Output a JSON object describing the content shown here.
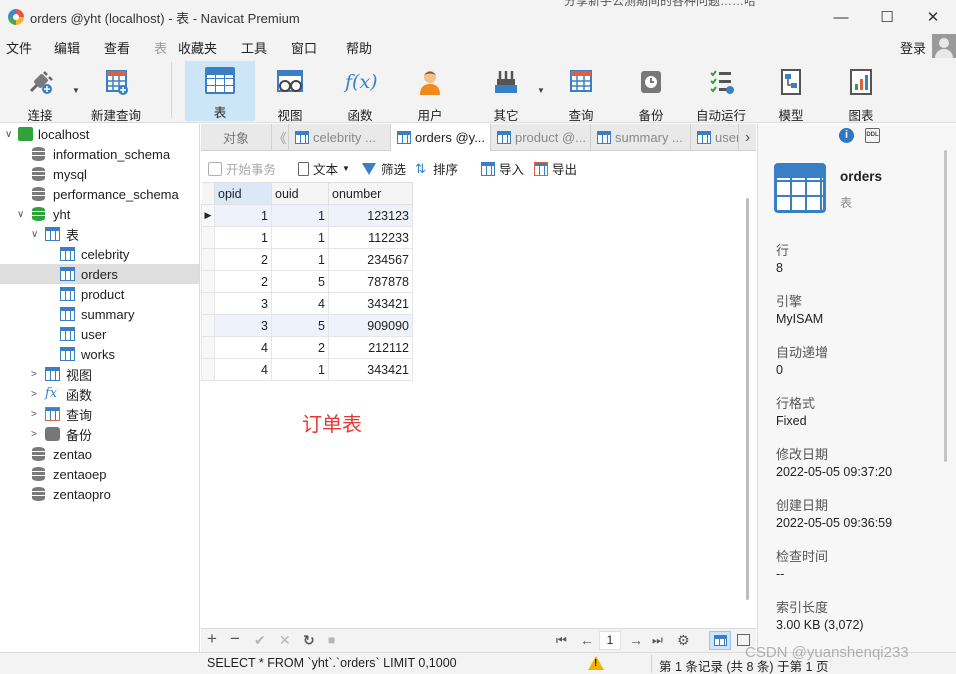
{
  "window": {
    "title": "orders @yht (localhost) - 表 - Navicat Premium",
    "ghost_text": "分享新手公测期间的各种问题……哈",
    "minimize": "—",
    "maximize": "☐",
    "close": "✕"
  },
  "menu": [
    "文件",
    "编辑",
    "查看",
    "表",
    "收藏夹",
    "工具",
    "窗口",
    "帮助"
  ],
  "login_label": "登录",
  "toolbar": [
    {
      "label": "连接",
      "icon": "plug-icon"
    },
    {
      "label": "新建查询",
      "icon": "new-query-icon"
    },
    {
      "label": "表",
      "icon": "table-icon",
      "active": true
    },
    {
      "label": "视图",
      "icon": "view-icon"
    },
    {
      "label": "函数",
      "icon": "function-icon",
      "glyph": "f(x)"
    },
    {
      "label": "用户",
      "icon": "user-icon"
    },
    {
      "label": "其它",
      "icon": "tools-icon"
    },
    {
      "label": "查询",
      "icon": "query-icon"
    },
    {
      "label": "备份",
      "icon": "backup-icon"
    },
    {
      "label": "自动运行",
      "icon": "automation-icon"
    },
    {
      "label": "模型",
      "icon": "model-icon"
    },
    {
      "label": "图表",
      "icon": "chart-icon"
    }
  ],
  "tree": [
    {
      "label": "localhost",
      "icon": "connection-icon",
      "arrow": "∨"
    },
    {
      "label": "information_schema",
      "icon": "database-icon"
    },
    {
      "label": "mysql",
      "icon": "database-icon"
    },
    {
      "label": "performance_schema",
      "icon": "database-icon"
    },
    {
      "label": "yht",
      "icon": "database-open-icon",
      "arrow": "∨"
    },
    {
      "label": "表",
      "icon": "tables-folder-icon",
      "arrow": "∨"
    },
    {
      "label": "celebrity",
      "icon": "table-icon"
    },
    {
      "label": "orders",
      "icon": "table-icon",
      "selected": true
    },
    {
      "label": "product",
      "icon": "table-icon"
    },
    {
      "label": "summary",
      "icon": "table-icon"
    },
    {
      "label": "user",
      "icon": "table-icon"
    },
    {
      "label": "works",
      "icon": "table-icon"
    },
    {
      "label": "视图",
      "icon": "views-folder-icon",
      "arrow": ">"
    },
    {
      "label": "函数",
      "icon": "functions-folder-icon",
      "arrow": ">",
      "glyph": "fx"
    },
    {
      "label": "查询",
      "icon": "queries-folder-icon",
      "arrow": ">"
    },
    {
      "label": "备份",
      "icon": "backups-folder-icon",
      "arrow": ">"
    },
    {
      "label": "zentao",
      "icon": "database-icon"
    },
    {
      "label": "zentaoep",
      "icon": "database-icon"
    },
    {
      "label": "zentaopro",
      "icon": "database-icon"
    }
  ],
  "tabs": {
    "objects_label": "对象",
    "items": [
      "celebrity ...",
      "orders @y...",
      "product @...",
      "summary ...",
      "user"
    ],
    "active_index": 1,
    "nav_left": "《",
    "nav_right": "›"
  },
  "data_toolbar": {
    "begin_tx": "开始事务",
    "text": "文本",
    "filter": "筛选",
    "sort": "排序",
    "import": "导入",
    "export": "导出"
  },
  "grid": {
    "columns": [
      "opid",
      "ouid",
      "onumber"
    ],
    "rows": [
      [
        "1",
        "1",
        "123123"
      ],
      [
        "1",
        "1",
        "112233"
      ],
      [
        "2",
        "1",
        "234567"
      ],
      [
        "2",
        "5",
        "787878"
      ],
      [
        "3",
        "4",
        "343421"
      ],
      [
        "3",
        "5",
        "909090"
      ],
      [
        "4",
        "2",
        "212112"
      ],
      [
        "4",
        "1",
        "343421"
      ]
    ],
    "current_row_marker": "▶"
  },
  "annotation": "订单表",
  "grid_footer": {
    "add": "+",
    "remove": "−",
    "apply": "✔",
    "discard": "✕",
    "refresh": "↻",
    "stop": "■",
    "first": "⏮",
    "prev": "←",
    "page": "1",
    "next": "→",
    "last": "⏭",
    "settings": "⚙"
  },
  "status": {
    "sql": "SELECT * FROM `yht`.`orders` LIMIT 0,1000",
    "records": "第 1 条记录 (共 8 条) 于第 1 页"
  },
  "info_panel": {
    "name": "orders",
    "type": "表",
    "info_btn": "i",
    "ddl_btn": "DDL",
    "fields": [
      {
        "label": "行",
        "value": "8"
      },
      {
        "label": "引擎",
        "value": "MyISAM"
      },
      {
        "label": "自动递增",
        "value": "0"
      },
      {
        "label": "行格式",
        "value": "Fixed"
      },
      {
        "label": "修改日期",
        "value": "2022-05-05 09:37:20"
      },
      {
        "label": "创建日期",
        "value": "2022-05-05 09:36:59"
      },
      {
        "label": "检查时间",
        "value": "--"
      },
      {
        "label": "索引长度",
        "value": "3.00 KB (3,072)"
      }
    ]
  },
  "watermark": "CSDN @yuanshenqi233",
  "colors": {
    "accent": "#3a7fc6",
    "annotation": "#e53935",
    "active_tool": "#cde6f7",
    "warning": "#f0b400"
  }
}
